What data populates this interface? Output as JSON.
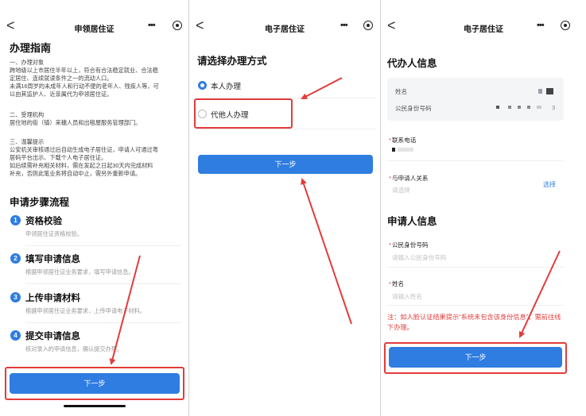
{
  "p1": {
    "title": "申领居住证",
    "back": "<",
    "more": "•••",
    "guide_title": "办理指南",
    "s1_head": "一、办理对象",
    "s1_lines": [
      "跨地级以上市居住半年以上，符合有合法稳定就业、合法稳",
      "定居住、连续就读条件之一的流动人口。",
      "未满16周岁的未成年人和行动不便的老年人、残疾人等，可",
      "以由其监护人、近亲属代为申领居住证。"
    ],
    "s2_head": "二、受理机构",
    "s2_lines": [
      "居住地的街（镇）来穗人员和出租屋服务管理部门。"
    ],
    "s3_head": "三、温馨提示",
    "s3_lines": [
      "公安机关审核通过后自动生成电子居住证，申请人可通过粤",
      "居码平台出示、下载个人电子居住证。",
      "如后续需补充相关材料，需在发起之日起30天内完成材料",
      "补充，否则此笔业务将自动中止，需另外重新申请。"
    ],
    "flow_title": "申请步骤流程",
    "steps": [
      {
        "n": "1",
        "title": "资格校验",
        "desc": "申领居住证资格校验。"
      },
      {
        "n": "2",
        "title": "填写申请信息",
        "desc": "根据申领居住证业务要求，填写申请信息。"
      },
      {
        "n": "3",
        "title": "上传申请材料",
        "desc": "根据申领居住证业务要求，上传申请电子材料。"
      },
      {
        "n": "4",
        "title": "提交申请信息",
        "desc": "核对录入的申请信息，确认提交办理。"
      }
    ],
    "next": "下一步"
  },
  "p2": {
    "title": "电子居住证",
    "back": "<",
    "more": "•••",
    "heading": "请选择办理方式",
    "opt_self": "本人办理",
    "opt_other": "代他人办理",
    "next": "下一步"
  },
  "p3": {
    "title": "电子居住证",
    "back": "<",
    "more": "•••",
    "agent_title": "代办人信息",
    "name_label": "姓名",
    "id_label": "公民身份号码",
    "id_tail": "3",
    "phone_label": "联系电话",
    "relation_label": "与申请人关系",
    "relation_ph": "请选择",
    "choose": "选择",
    "applicant_title": "申请人信息",
    "app_id_label": "公民身份号码",
    "app_id_ph": "请输入公民身份号码",
    "app_name_label": "姓名",
    "app_name_ph": "请输入姓名",
    "star": "*",
    "note": "注：如人脸认证结果提示“系统未包含该身份信息”，需前往线下办理。",
    "next": "下一步"
  },
  "colors": {
    "primary": "#2f7de1",
    "annotation": "#e23b3b"
  }
}
